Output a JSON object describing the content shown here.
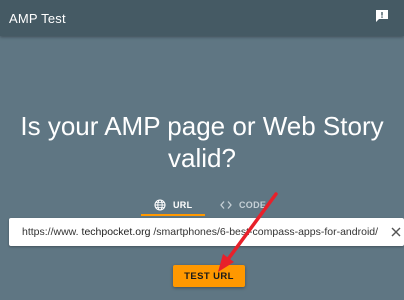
{
  "app_bar": {
    "title": "AMP Test",
    "feedback_icon": "feedback-icon",
    "background": "#455a64"
  },
  "main": {
    "headline_line1": "Is your AMP page or Web Story",
    "headline_line2": "valid?",
    "background": "#5f7683"
  },
  "tabs": [
    {
      "label": "URL",
      "icon": "globe-icon",
      "selected": true
    },
    {
      "label": "CODE",
      "icon": "code-icon",
      "selected": false
    }
  ],
  "url_input": {
    "prefix": "https://www.",
    "host": "techpocket.org",
    "path": "/smartphones/6-best-compass-apps-for-android/",
    "clear_icon": "close-icon"
  },
  "test_button": {
    "label": "TEST URL",
    "color": "#ff9800"
  },
  "annotation": {
    "arrow_color": "#e8202a"
  }
}
